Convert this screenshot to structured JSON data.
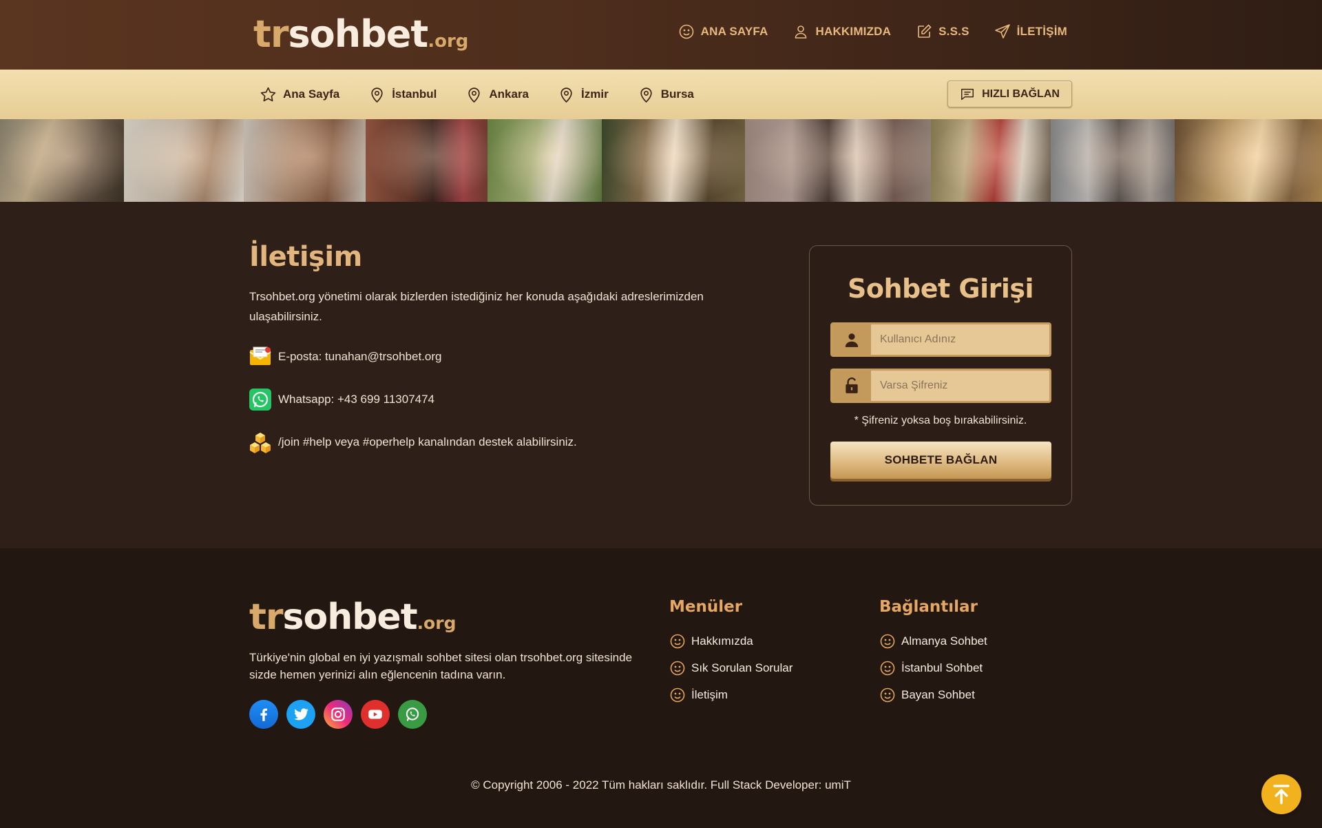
{
  "brand": {
    "logo_prefix": "tr",
    "logo_main": "sohbet",
    "logo_ext": ".org"
  },
  "top_nav": [
    {
      "label": "ANA SAYFA",
      "icon": "smile-icon"
    },
    {
      "label": "HAKKIMIZDA",
      "icon": "user-icon"
    },
    {
      "label": "S.S.S",
      "icon": "edit-icon"
    },
    {
      "label": "İLETİŞİM",
      "icon": "send-icon"
    }
  ],
  "sub_nav": [
    {
      "label": "Ana Sayfa",
      "icon": "star-icon"
    },
    {
      "label": "İstanbul",
      "icon": "location-pin-icon"
    },
    {
      "label": "Ankara",
      "icon": "location-pin-icon"
    },
    {
      "label": "İzmir",
      "icon": "location-pin-icon"
    },
    {
      "label": "Bursa",
      "icon": "location-pin-icon"
    }
  ],
  "quick_connect_label": "HIZLI BAĞLAN",
  "contact": {
    "title": "İletişim",
    "intro": "Trsohbet.org yönetimi olarak bizlerden istediğiniz her konuda aşağıdaki adreslerimizden ulaşabilirsiniz.",
    "email": "E-posta: tunahan@trsohbet.org",
    "whatsapp": "Whatsapp: +43 699 11307474",
    "irc": "/join #help veya #operhelp kanalından destek alabilirsiniz."
  },
  "login": {
    "title": "Sohbet Girişi",
    "username_placeholder": "Kullanıcı Adınız",
    "password_placeholder": "Varsa Şifreniz",
    "note": "* Şifreniz yoksa boş bırakabilirsiniz.",
    "submit_label": "SOHBETE BAĞLAN"
  },
  "footer": {
    "description": "Türkiye'nin global en iyi yazışmalı sohbet sitesi olan trsohbet.org sitesinde sizde hemen yerinizi alın eğlencenin tadına varın.",
    "socials": [
      "facebook-icon",
      "twitter-icon",
      "instagram-icon",
      "youtube-icon",
      "whatsapp-icon"
    ],
    "menus_title": "Menüler",
    "menus": [
      "Hakkımızda",
      "Sık Sorulan Sorular",
      "İletişim"
    ],
    "links_title": "Bağlantılar",
    "links": [
      "Almanya Sohbet",
      "İstanbul Sohbet",
      "Bayan Sohbet"
    ],
    "copyright": "© Copyright 2006 - 2022 Tüm hakları saklıdır. Full Stack Developer: umiT"
  },
  "colors": {
    "header_brown": "#4d2d1c",
    "subnav_cream": "#ecd6a2",
    "accent_gold": "#e2b57f",
    "footer_heading": "#e6a764",
    "scroll_top_button": "#f2b21e"
  }
}
